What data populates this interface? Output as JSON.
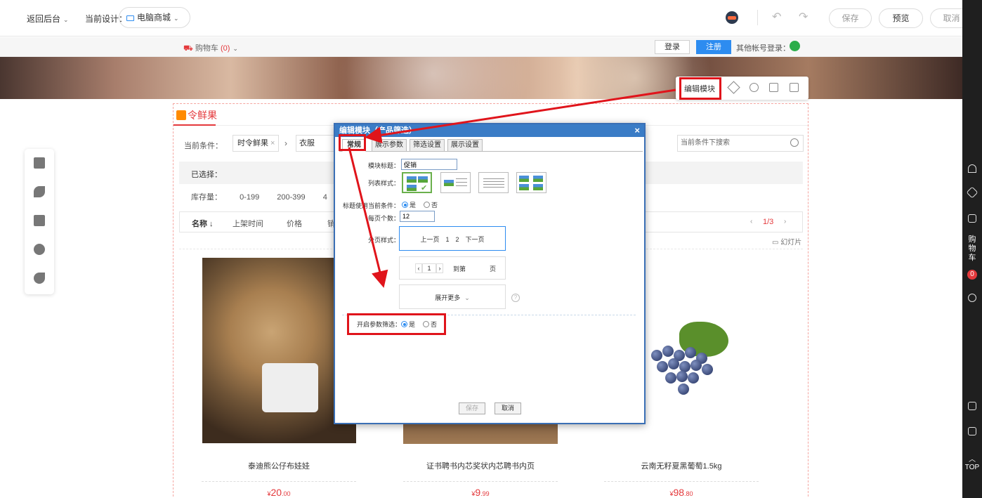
{
  "topbar": {
    "back_label": "返回后台",
    "current_design_label": "当前设计：",
    "design_name": "电脑商城",
    "save_label": "保存",
    "preview_label": "预览",
    "cancel_label": "取消"
  },
  "site_header": {
    "cart_label": "购物车",
    "cart_count": "(0)",
    "login_label": "登录",
    "register_label": "注册",
    "other_login_label": "其他帐号登录："
  },
  "module_toolbar": {
    "edit_label": "编辑模块"
  },
  "right_sidebar": {
    "cart_chars": [
      "购",
      "物",
      "车"
    ],
    "cart_badge": "0",
    "top_label": "TOP"
  },
  "module": {
    "title": "令鲜果",
    "condition_label": "当前条件：",
    "condition_chip": "时令鲜果",
    "condition_chip2": "衣服",
    "search_placeholder": "当前条件下搜索",
    "selected_label": "已选择：",
    "stock_label": "库存量：",
    "stock_ranges": [
      "0-199",
      "200-399",
      "4"
    ],
    "sort_items": [
      "名称 ↓",
      "上架时间",
      "价格",
      "销"
    ],
    "page_indicator": "1/3",
    "slideshow_label": "幻灯片",
    "products": [
      {
        "name": "泰迪熊公仔布娃娃",
        "price_int": "20",
        "price_dec": ".00"
      },
      {
        "name": "证书聘书内芯奖状内芯聘书内页",
        "price_int": "9",
        "price_dec": ".99"
      },
      {
        "name": "云南无籽夏黑葡萄1.5kg",
        "price_int": "98",
        "price_dec": ".80"
      }
    ],
    "currency": "¥"
  },
  "dialog": {
    "title": "编辑模块（产品筛选）",
    "close": "×",
    "tabs": [
      "常规",
      "展示参数",
      "筛选设置",
      "展示设置"
    ],
    "module_title_label": "模块标题：",
    "module_title_value": "促销",
    "list_style_label": "列表样式：",
    "use_condition_label": "标题使用当前条件：",
    "yes": "是",
    "no": "否",
    "per_page_label": "每页个数：",
    "per_page_value": "12",
    "pager_style_label": "分页样式：",
    "pager_style1": "上一页　1　2　下一页",
    "pager_style2_current": "1",
    "pager_style2_goto": "到第",
    "pager_style2_page": "页",
    "expand_more": "展开更多",
    "param_filter_label": "开启参数筛选：",
    "save_label": "保存",
    "cancel_label": "取消"
  },
  "colors": {
    "accent_blue": "#2d8cf0",
    "highlight_red": "#e0141b",
    "price_red": "#e4393c"
  }
}
